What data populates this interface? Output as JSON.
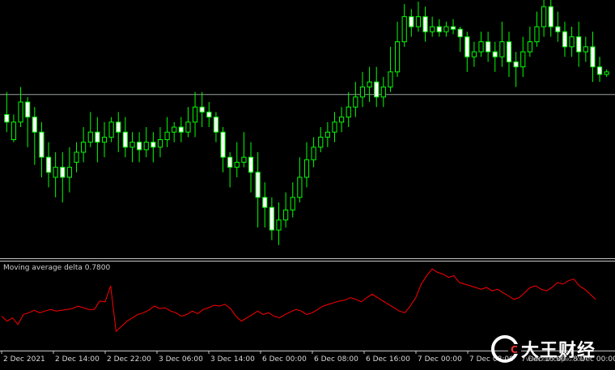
{
  "chart_data": [
    {
      "type": "candlestick",
      "title": "",
      "ylim": [
        0,
        100
      ],
      "hline": 63,
      "bull_color": "#00ff00",
      "bear_color": "#ffffff",
      "candles": [
        [
          55,
          52,
          64,
          48
        ],
        [
          45,
          52,
          55,
          44
        ],
        [
          52,
          60,
          66,
          50
        ],
        [
          60,
          54,
          62,
          42
        ],
        [
          54,
          48,
          58,
          35
        ],
        [
          48,
          38,
          52,
          30
        ],
        [
          38,
          32,
          44,
          26
        ],
        [
          30,
          34,
          40,
          22
        ],
        [
          34,
          30,
          40,
          20
        ],
        [
          30,
          34,
          42,
          24
        ],
        [
          36,
          40,
          44,
          32
        ],
        [
          40,
          44,
          50,
          36
        ],
        [
          44,
          48,
          56,
          42
        ],
        [
          48,
          44,
          54,
          36
        ],
        [
          44,
          46,
          52,
          38
        ],
        [
          46,
          52,
          54,
          44
        ],
        [
          52,
          48,
          56,
          40
        ],
        [
          48,
          42,
          54,
          38
        ],
        [
          42,
          44,
          48,
          36
        ],
        [
          44,
          41,
          48,
          36
        ],
        [
          41,
          44,
          50,
          38
        ],
        [
          44,
          42,
          48,
          36
        ],
        [
          42,
          45,
          50,
          38
        ],
        [
          45,
          48,
          54,
          42
        ],
        [
          48,
          50,
          52,
          44
        ],
        [
          50,
          48,
          54,
          44
        ],
        [
          48,
          52,
          58,
          46
        ],
        [
          52,
          58,
          64,
          46
        ],
        [
          58,
          56,
          64,
          50
        ],
        [
          56,
          54,
          60,
          50
        ],
        [
          54,
          48,
          56,
          44
        ],
        [
          48,
          38,
          50,
          32
        ],
        [
          38,
          34,
          40,
          26
        ],
        [
          34,
          36,
          44,
          30
        ],
        [
          36,
          38,
          48,
          34
        ],
        [
          38,
          32,
          44,
          24
        ],
        [
          32,
          22,
          40,
          10
        ],
        [
          22,
          18,
          28,
          10
        ],
        [
          18,
          9,
          22,
          5
        ],
        [
          9,
          13,
          20,
          3
        ],
        [
          13,
          17,
          24,
          10
        ],
        [
          17,
          22,
          28,
          14
        ],
        [
          22,
          30,
          38,
          20
        ],
        [
          30,
          37,
          44,
          26
        ],
        [
          37,
          42,
          46,
          34
        ],
        [
          42,
          46,
          50,
          40
        ],
        [
          46,
          48,
          52,
          42
        ],
        [
          48,
          52,
          56,
          44
        ],
        [
          52,
          54,
          58,
          48
        ],
        [
          54,
          58,
          64,
          50
        ],
        [
          58,
          62,
          68,
          54
        ],
        [
          62,
          66,
          72,
          58
        ],
        [
          66,
          68,
          74,
          60
        ],
        [
          68,
          62,
          74,
          58
        ],
        [
          62,
          66,
          70,
          58
        ],
        [
          66,
          72,
          82,
          64
        ],
        [
          72,
          84,
          92,
          70
        ],
        [
          84,
          94,
          99,
          82
        ],
        [
          94,
          90,
          97,
          86
        ],
        [
          90,
          94,
          100,
          88
        ],
        [
          94,
          88,
          98,
          84
        ],
        [
          88,
          90,
          94,
          86
        ],
        [
          90,
          88,
          93,
          86
        ],
        [
          88,
          90,
          92,
          86
        ],
        [
          90,
          89,
          93,
          87
        ],
        [
          89,
          86,
          90,
          80
        ],
        [
          86,
          78,
          88,
          72
        ],
        [
          78,
          80,
          84,
          74
        ],
        [
          80,
          84,
          88,
          78
        ],
        [
          84,
          80,
          88,
          76
        ],
        [
          80,
          78,
          84,
          72
        ],
        [
          78,
          84,
          92,
          74
        ],
        [
          84,
          76,
          88,
          70
        ],
        [
          76,
          74,
          80,
          66
        ],
        [
          74,
          80,
          86,
          70
        ],
        [
          80,
          84,
          90,
          78
        ],
        [
          84,
          90,
          96,
          82
        ],
        [
          90,
          98,
          102,
          86
        ],
        [
          98,
          90,
          102,
          86
        ],
        [
          90,
          88,
          96,
          84
        ],
        [
          88,
          82,
          92,
          78
        ],
        [
          82,
          86,
          90,
          78
        ],
        [
          86,
          80,
          92,
          74
        ],
        [
          80,
          82,
          86,
          76
        ],
        [
          82,
          74,
          88,
          68
        ],
        [
          74,
          71,
          78,
          68
        ],
        [
          71,
          72,
          73,
          70
        ]
      ]
    },
    {
      "type": "line",
      "title": "Moving average delta 0.7800",
      "line_color": "#ff0000",
      "ylim": [
        0,
        100
      ],
      "values": [
        38,
        32,
        36,
        28,
        40,
        42,
        45,
        42,
        44,
        46,
        44,
        45,
        46,
        47,
        50,
        48,
        46,
        46,
        56,
        55,
        74,
        20,
        26,
        32,
        36,
        40,
        42,
        45,
        50,
        47,
        48,
        44,
        42,
        38,
        40,
        44,
        41,
        46,
        48,
        51,
        50,
        52,
        47,
        38,
        32,
        36,
        40,
        44,
        40,
        42,
        38,
        36,
        40,
        43,
        46,
        44,
        40,
        42,
        46,
        50,
        52,
        54,
        56,
        57,
        60,
        58,
        55,
        60,
        64,
        60,
        56,
        52,
        48,
        44,
        42,
        50,
        60,
        76,
        86,
        94,
        90,
        88,
        84,
        86,
        78,
        76,
        74,
        72,
        70,
        72,
        68,
        70,
        66,
        62,
        58,
        60,
        66,
        72,
        74,
        70,
        68,
        72,
        78,
        76,
        80,
        82,
        74,
        70,
        64,
        58
      ]
    },
    {
      "type": "axis",
      "x_tick_labels": [
        "2 Dec 2021",
        "2 Dec 14:00",
        "2 Dec 22:00",
        "3 Dec 06:00",
        "3 Dec 14:00",
        "6 Dec 00:00",
        "6 Dec 08:00",
        "6 Dec 16:00",
        "7 Dec 00:00",
        "7 Dec 08:00",
        "7 Dec 16:00",
        "8 Dec 00:00"
      ]
    }
  ],
  "watermark": {
    "text": "大王财经",
    "sub": "WWW.KINGCAIJING.COM"
  }
}
